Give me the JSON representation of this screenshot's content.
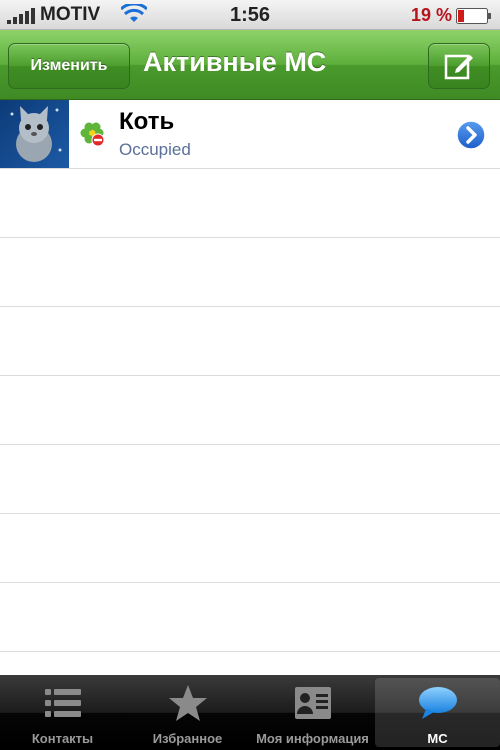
{
  "status_bar": {
    "carrier": "MOTIV",
    "time": "1:56",
    "battery": "19 %",
    "signal_icon": "signal-bars-icon",
    "wifi_icon": "wifi-icon",
    "battery_icon": "battery-icon"
  },
  "nav": {
    "edit_label": "Изменить",
    "title": "Активные МС",
    "compose_icon": "compose-icon",
    "accent_color": "#5dae3b"
  },
  "conversations": [
    {
      "name": "Коть",
      "status": "Occupied",
      "avatar_icon": "cat-avatar",
      "status_icon": "icq-occupied-icon",
      "disclosure_icon": "chevron-right-icon"
    }
  ],
  "tabs": [
    {
      "label": "Контакты",
      "icon": "list-icon",
      "active": false
    },
    {
      "label": "Избранное",
      "icon": "star-icon",
      "active": false
    },
    {
      "label": "Моя информация",
      "icon": "contact-card-icon",
      "active": false
    },
    {
      "label": "МС",
      "icon": "speech-bubble-icon",
      "active": true
    }
  ]
}
